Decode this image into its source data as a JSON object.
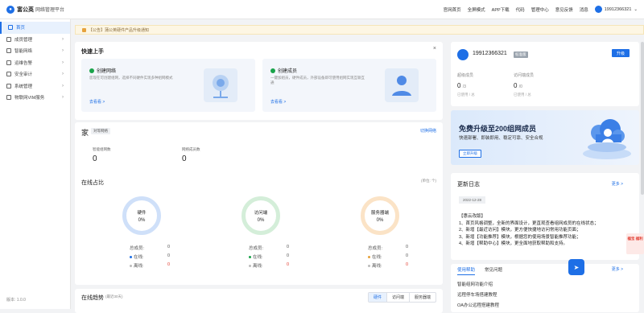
{
  "brand": {
    "name": "富公英",
    "product": "网络管理平台"
  },
  "topnav": {
    "items": [
      "官网首页",
      "全屏模式",
      "APP下载",
      "代码",
      "管理中心",
      "意见反馈",
      "消息"
    ],
    "user": "19912366321"
  },
  "sidebar": {
    "items": [
      {
        "label": "首页",
        "active": true
      },
      {
        "label": "成员管理"
      },
      {
        "label": "智能网络"
      },
      {
        "label": "运维告警"
      },
      {
        "label": "安全审计"
      },
      {
        "label": "系统管理"
      },
      {
        "label": "物联网VIM服务"
      }
    ],
    "version": "版本: 1.0.0"
  },
  "notice": "【公告】蒲公英硬件产品升级通知",
  "quickstart": {
    "title": "快速上手",
    "close": "×",
    "boxes": [
      {
        "title": "创建网络",
        "desc": "您现在可创建组网，选择不同硬件实现多种组网模式",
        "link": "去看看 >"
      },
      {
        "title": "创建成员",
        "desc": "一键加组员，硬件成员，外部设备即可使用组网实现互联互通",
        "link": "去看看 >"
      }
    ]
  },
  "home": {
    "title": "家",
    "tag": "对等网络",
    "switch": "切换网络",
    "stats": [
      {
        "label": "智能组网数",
        "value": "0"
      },
      {
        "label": "网络成员数",
        "value": "0"
      }
    ],
    "online_title": "在线占比",
    "unit": "(单位: 个)",
    "rings": [
      {
        "name": "硬件",
        "pct": "0%",
        "color": "#cfe0f9",
        "total": "0",
        "online": "0",
        "offline": "0"
      },
      {
        "name": "访问端",
        "pct": "0%",
        "color": "#d4eed9",
        "total": "0",
        "online": "0",
        "offline": "0"
      },
      {
        "name": "服务器端",
        "pct": "0%",
        "color": "#fbe3c6",
        "total": "0",
        "online": "0",
        "offline": "0"
      }
    ],
    "labels": {
      "total": "总成员:",
      "online": "在线:",
      "offline": "离线:"
    }
  },
  "trend": {
    "title": "在线趋势",
    "sub": "(最近30天)",
    "tabs": [
      "硬件",
      "访问端",
      "服务器端"
    ]
  },
  "usercard": {
    "name": "19912366321",
    "badge": "标准版",
    "upgrade": "升级",
    "cols": [
      {
        "label": "超级成员",
        "value": "0",
        "max": "/3",
        "sub": "已使用 / 总"
      },
      {
        "label": "访问端成员",
        "value": "0",
        "max": "/0",
        "sub": "已使用 / 总"
      }
    ]
  },
  "banner": {
    "title": "免费升级至200组网成员",
    "sub": "快速部署、即装即用、稳定可靠、安全合规",
    "btn": "立即升级"
  },
  "changelog": {
    "title": "更新日志",
    "more": "更多 >",
    "date": "2022-12-28",
    "lines": [
      "【惠云改版】",
      "1、首页风格调整，全新的界面设计，更直观查看组网成员的在线状态；",
      "2、新增【最近访问】模块，更方便快捷地访问常用功能页面；",
      "3、新增【功能推荐】模块，根据您的使用场景智能推荐功能；",
      "4、新增【帮助中心】模块，更全面地获取帮助和支持。"
    ]
  },
  "help": {
    "tabs": [
      "使用帮助",
      "常见问题"
    ],
    "more": "更多 >",
    "lines": [
      "智能组网功能介绍",
      "远程停车场搭建教程",
      "OA办公远程搭建教程"
    ]
  },
  "floats": {
    "gift": "福宝 福利"
  }
}
